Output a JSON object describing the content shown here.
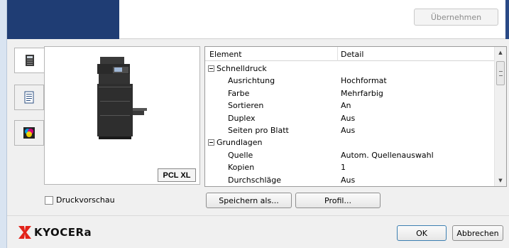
{
  "header": {
    "apply_label": "Übernehmen"
  },
  "tabs": [
    {
      "icon": "printer-icon"
    },
    {
      "icon": "document-icon"
    },
    {
      "icon": "color-icon"
    }
  ],
  "preview": {
    "pdl_label": "PCL XL"
  },
  "table": {
    "columns": [
      "Element",
      "Detail"
    ],
    "rows": [
      {
        "kind": "group",
        "label": "Schnelldruck"
      },
      {
        "kind": "item",
        "label": "Ausrichtung",
        "value": "Hochformat"
      },
      {
        "kind": "item",
        "label": "Farbe",
        "value": "Mehrfarbig"
      },
      {
        "kind": "item",
        "label": "Sortieren",
        "value": "An"
      },
      {
        "kind": "item",
        "label": "Duplex",
        "value": "Aus"
      },
      {
        "kind": "item",
        "label": "Seiten pro Blatt",
        "value": "Aus"
      },
      {
        "kind": "group",
        "label": "Grundlagen"
      },
      {
        "kind": "item",
        "label": "Quelle",
        "value": "Autom. Quellenauswahl"
      },
      {
        "kind": "item",
        "label": "Kopien",
        "value": "1"
      },
      {
        "kind": "item",
        "label": "Durchschläge",
        "value": "Aus"
      }
    ]
  },
  "footer": {
    "preview_checkbox_label": "Druckvorschau",
    "save_as_label": "Speichern als...",
    "profile_label": "Profil...",
    "ok_label": "OK",
    "cancel_label": "Abbrechen",
    "brand": "KYOCERa"
  },
  "colors": {
    "brand_red": "#e2231a",
    "header_blue": "#1f3d74"
  }
}
